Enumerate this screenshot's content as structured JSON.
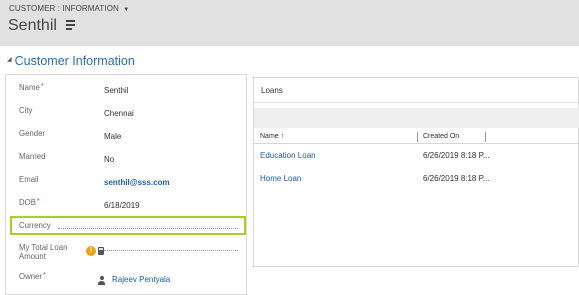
{
  "header": {
    "breadcrumb": "CUSTOMER : INFORMATION",
    "breadcrumb_caret": "▼",
    "record_name": "Senthil"
  },
  "section": {
    "title": "Customer Information",
    "collapse_glyph": "◢"
  },
  "form": {
    "required_marker": "*",
    "fields": {
      "name": {
        "label": "Name",
        "value": "Senthil"
      },
      "city": {
        "label": "City",
        "value": "Chennai"
      },
      "gender": {
        "label": "Gender",
        "value": "Male"
      },
      "married": {
        "label": "Married",
        "value": "No"
      },
      "email": {
        "label": "Email",
        "value": "senthil@sss.com"
      },
      "dob": {
        "label": "DOB",
        "value": "6/18/2019"
      },
      "currency": {
        "label": "Currency",
        "value": ""
      },
      "total_loan": {
        "label_line1": "My Total Loan",
        "label_line2": "Amount",
        "value": ""
      },
      "owner": {
        "label": "Owner",
        "value": "Rajeev Pentyala"
      }
    },
    "warning_glyph": "!"
  },
  "loans": {
    "title": "Loans",
    "columns": {
      "name": "Name ↑",
      "created_on": "Created On"
    },
    "rows": [
      {
        "name": "Education Loan",
        "created_on": "6/26/2019 8:18 P..."
      },
      {
        "name": "Home Loan",
        "created_on": "6/26/2019 8:18 P..."
      }
    ]
  },
  "colors": {
    "accent_blue": "#2a6fb0",
    "link_blue": "#1f5eac",
    "highlight_green": "#a6cf2a",
    "required_red": "#e0253b",
    "warning_orange": "#e8a317"
  }
}
